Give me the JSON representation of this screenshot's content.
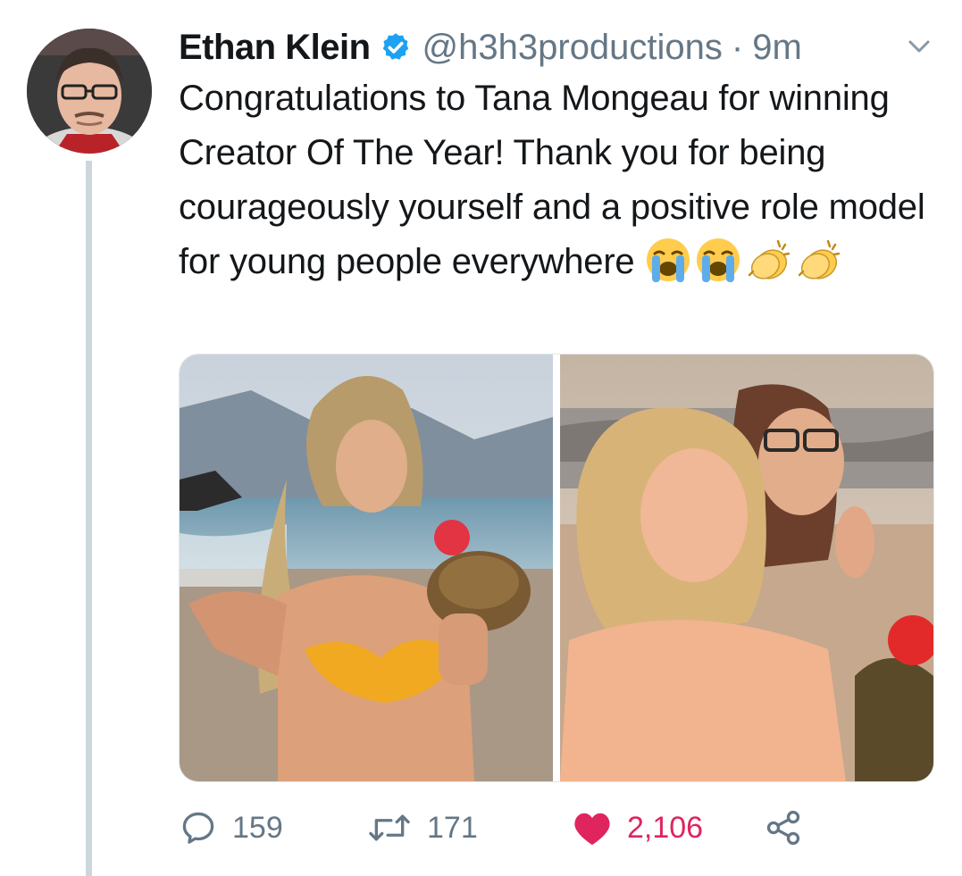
{
  "tweet": {
    "author_name": "Ethan Klein",
    "handle": "@h3h3productions",
    "separator": "·",
    "time": "9m",
    "verified": true,
    "text": "Congratulations to Tana Mongeau for winning Creator Of The Year! Thank you for being courageously yourself and a positive role model for young people everywhere",
    "emojis": [
      "loudly-crying-face",
      "loudly-crying-face",
      "clapping-hands",
      "clapping-hands"
    ],
    "media_count": 2
  },
  "actions": {
    "reply_count": "159",
    "retweet_count": "171",
    "like_count": "2,106",
    "liked": true
  },
  "colors": {
    "verified_blue": "#1da1f2",
    "secondary_text": "#657786",
    "like_red": "#e0245e",
    "thread_line": "#ccd6dd"
  },
  "icons": {
    "reply": "reply-icon",
    "retweet": "retweet-icon",
    "like": "heart-icon",
    "share": "share-icon",
    "menu": "chevron-down-icon"
  }
}
